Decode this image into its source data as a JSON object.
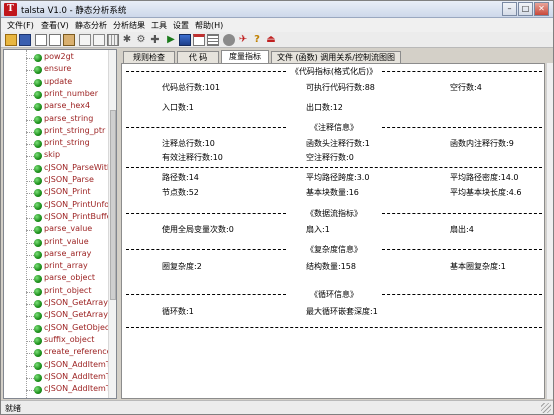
{
  "window": {
    "title": "talsta V1.0 - 静态分析系统",
    "icon_letter": "T"
  },
  "menu": [
    "文件(F)",
    "查看(V)",
    "静态分析",
    "分析结果",
    "工具",
    "设置",
    "帮助(H)"
  ],
  "toolbar_icons": [
    "open-folder-icon",
    "save-icon",
    "copy-icon",
    "cut-icon",
    "paste-icon",
    "doc-icon",
    "doc-icon",
    "grid-icon",
    "tools-icon",
    "gear-icon",
    "plus-icon",
    "play-icon",
    "chart-icon",
    "report-icon",
    "list-icon",
    "circle-icon",
    "arrow-icon",
    "question-icon",
    "exit-icon"
  ],
  "tree": {
    "items": [
      "pow2gt",
      "ensure",
      "update",
      "print_number",
      "parse_hex4",
      "parse_string",
      "print_string_ptr",
      "print_string",
      "skip",
      "cJSON_ParseWithO",
      "cJSON_Parse",
      "cJSON_Print",
      "cJSON_PrintUnfor",
      "cJSON_PrintBuffer",
      "parse_value",
      "print_value",
      "parse_array",
      "print_array",
      "parse_object",
      "print_object",
      "cJSON_GetArraySi",
      "cJSON_GetArrayIt",
      "cJSON_GetObjectI",
      "suffix_object",
      "create_reference",
      "cJSON_AddItemTo",
      "cJSON_AddItemTo",
      "cJSON_AddItemTo"
    ]
  },
  "tabs": [
    "规则检查",
    "代 码",
    "度量指标",
    "文件 (函数) 调用关系/控制流图图"
  ],
  "active_tab": 2,
  "metrics": {
    "sec_code": "《代码指标(格式化后)》",
    "total_lines": "代码总行数:101",
    "exec_lines": "可执行代码行数:88",
    "blank_lines": "空行数:4",
    "entry_points": "入口数:1",
    "exit_points": "出口数:12",
    "sec_comment": "《注释信息》",
    "comment_total": "注释总行数:10",
    "func_header_comment": "函数头注释行数:1",
    "func_inner_comment": "函数内注释行数:9",
    "valid_comment": "有效注释行数:10",
    "blank_comment": "空注释行数:0",
    "paths": "路径数:14",
    "avg_path_span": "平均路径跨度:3.0",
    "avg_path_density": "平均路径密度:14.0",
    "nodes": "节点数:52",
    "basic_blocks": "基本块数量:16",
    "avg_block_len": "平均基本块长度:4.6",
    "sec_dataflow": "《数据流指标》",
    "global_vars": "使用全局变量次数:0",
    "fan_in": "扇入:1",
    "fan_out": "扇出:4",
    "sec_complexity": "《复杂度信息》",
    "cyclomatic": "圈复杂度:2",
    "structures": "结构数量:158",
    "essential": "基本圈复杂度:1",
    "sec_loop": "《循环信息》",
    "loops": "循环数:1",
    "max_nesting": "最大循环嵌套深度:1"
  },
  "status": "就绪"
}
